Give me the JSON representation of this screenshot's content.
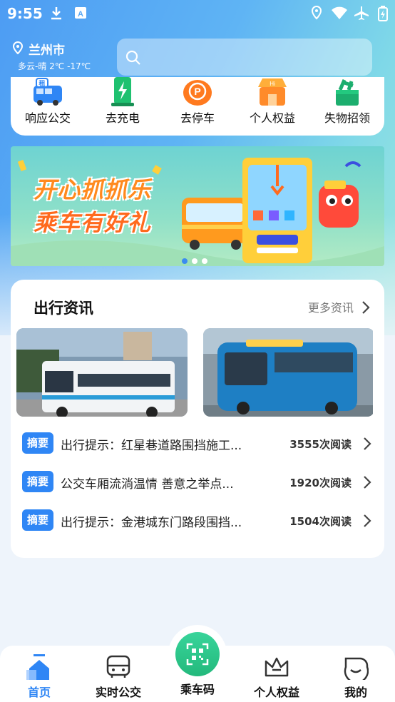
{
  "status_bar": {
    "time": "9:55"
  },
  "location": {
    "city": "兰州市",
    "weather": "多云-晴  2℃ -17℃"
  },
  "search": {
    "placeholder": ""
  },
  "quick_actions": [
    {
      "label": "响应公交",
      "icon": "bus-rental-icon"
    },
    {
      "label": "去充电",
      "icon": "charging-icon"
    },
    {
      "label": "去停车",
      "icon": "parking-icon"
    },
    {
      "label": "个人权益",
      "icon": "shop-icon"
    },
    {
      "label": "失物招领",
      "icon": "lost-found-icon"
    }
  ],
  "banner": {
    "line1": "开心抓抓乐",
    "line2": "乘车有好礼",
    "active_index": 0,
    "count": 3
  },
  "news": {
    "title": "出行资讯",
    "more_label": "更多资讯",
    "items": [
      {
        "tag": "摘要",
        "text": "出行提示：红星巷道路围挡施工...",
        "reads": "3555次阅读"
      },
      {
        "tag": "摘要",
        "text": "公交车厢流淌温情 善意之举点...",
        "reads": "1920次阅读"
      },
      {
        "tag": "摘要",
        "text": "出行提示：金港城东门路段围挡...",
        "reads": "1504次阅读"
      }
    ]
  },
  "tabbar": {
    "home": "首页",
    "realtime": "实时公交",
    "ride_code": "乘车码",
    "rights": "个人权益",
    "mine": "我的"
  },
  "colors": {
    "accent": "#2f86f5",
    "green": "#23b97c"
  }
}
